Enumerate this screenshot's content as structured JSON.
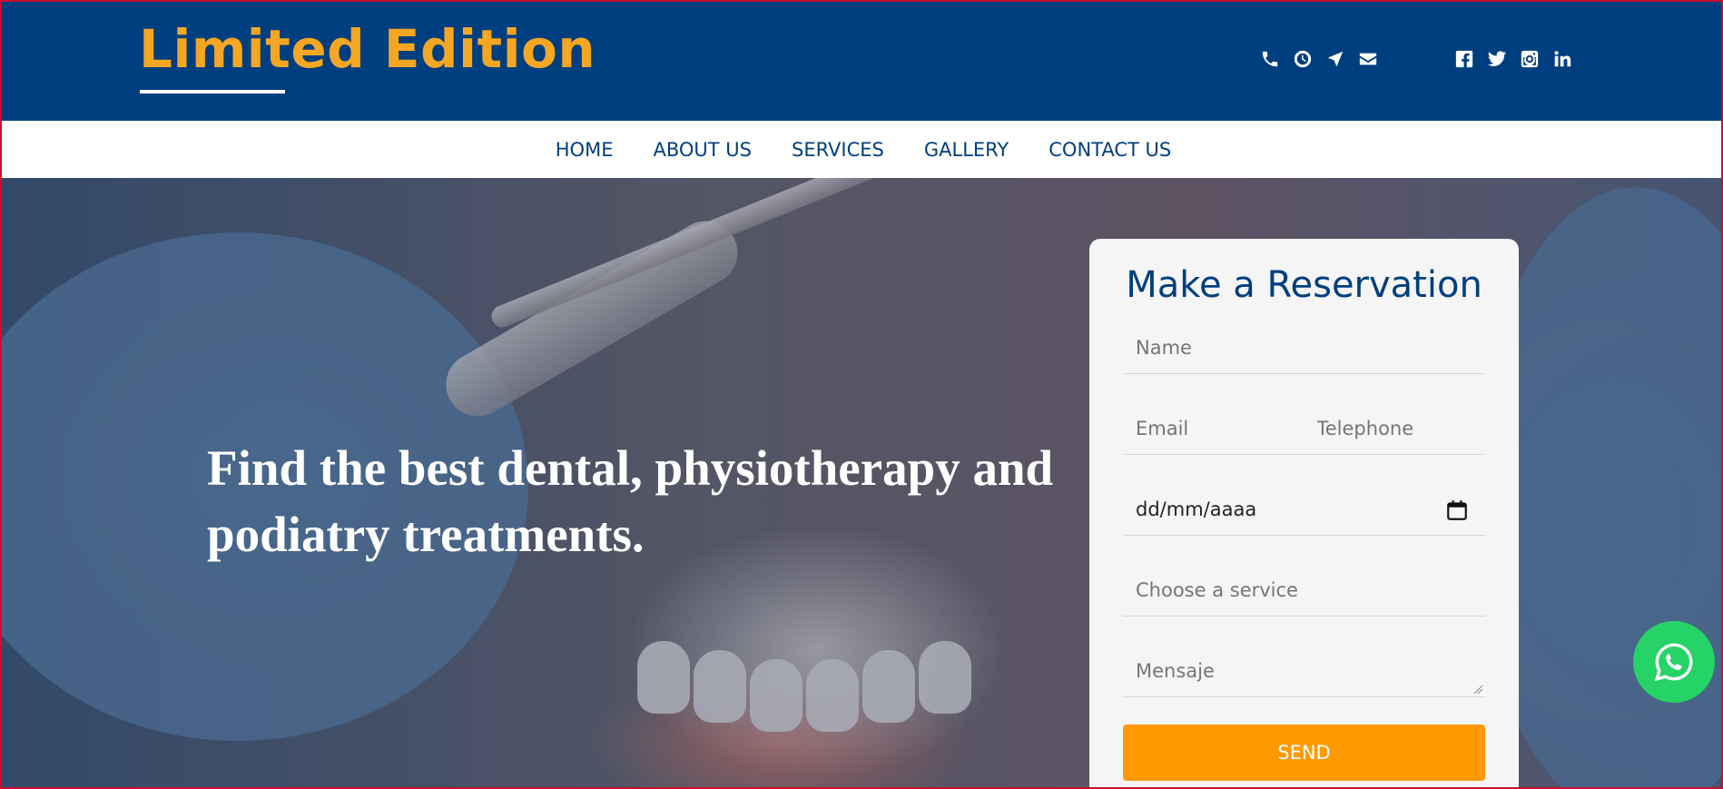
{
  "header": {
    "brand": "Limited Edition",
    "contact_icons": [
      "phone-icon",
      "clock-icon",
      "location-arrow-icon",
      "envelope-icon"
    ],
    "social_icons": [
      "facebook-icon",
      "twitter-icon",
      "instagram-icon",
      "linkedin-icon"
    ]
  },
  "nav": {
    "items": [
      {
        "label": "HOME"
      },
      {
        "label": "ABOUT US"
      },
      {
        "label": "SERVICES"
      },
      {
        "label": "GALLERY"
      },
      {
        "label": "CONTACT US"
      }
    ]
  },
  "hero": {
    "title": "Find the best dental, physiotherapy and podiatry treatments."
  },
  "reservation": {
    "title": "Make a Reservation",
    "name_placeholder": "Name",
    "email_placeholder": "Email",
    "telephone_placeholder": "Telephone",
    "date_value": "dd/mm/aaaa",
    "service_placeholder": "Choose a service",
    "message_placeholder": "Mensaje",
    "send_label": "SEND"
  },
  "colors": {
    "header_bg": "#003f7f",
    "brand": "#f5a623",
    "send_button": "#ff9900",
    "whatsapp": "#25d366"
  },
  "floating": {
    "whatsapp_icon": "whatsapp-icon"
  }
}
